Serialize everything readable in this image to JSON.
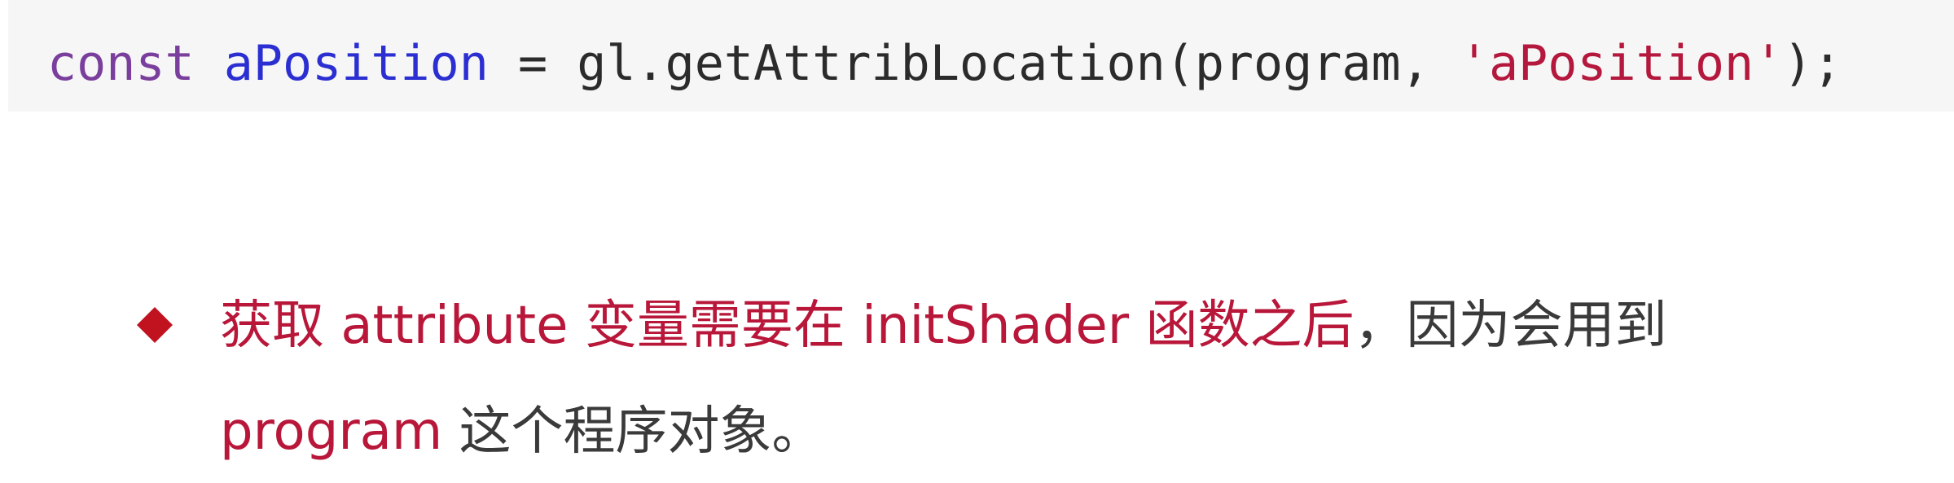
{
  "code": {
    "tokens": [
      {
        "text": "const",
        "kind": "keyword"
      },
      {
        "text": " ",
        "kind": "plain"
      },
      {
        "text": "aPosition",
        "kind": "variable"
      },
      {
        "text": " = gl.getAttribLocation(program, ",
        "kind": "plain"
      },
      {
        "text": "'aPosition'",
        "kind": "string"
      },
      {
        "text": ");",
        "kind": "plain"
      }
    ]
  },
  "note": {
    "red_text": "获取 attribute 变量需要在 initShader 函数之后",
    "dark_text_1": "，因为会用到",
    "red_text_2": "program",
    "dark_text_2": " 这个程序对象。"
  },
  "colors": {
    "keyword": "#7a3e9d",
    "variable": "#2b2fd1",
    "string": "#b4183c",
    "accent_red": "#b8173a",
    "body_text": "#3a3a3a"
  },
  "icons": {
    "bullet": "diamond-bullet-icon"
  }
}
